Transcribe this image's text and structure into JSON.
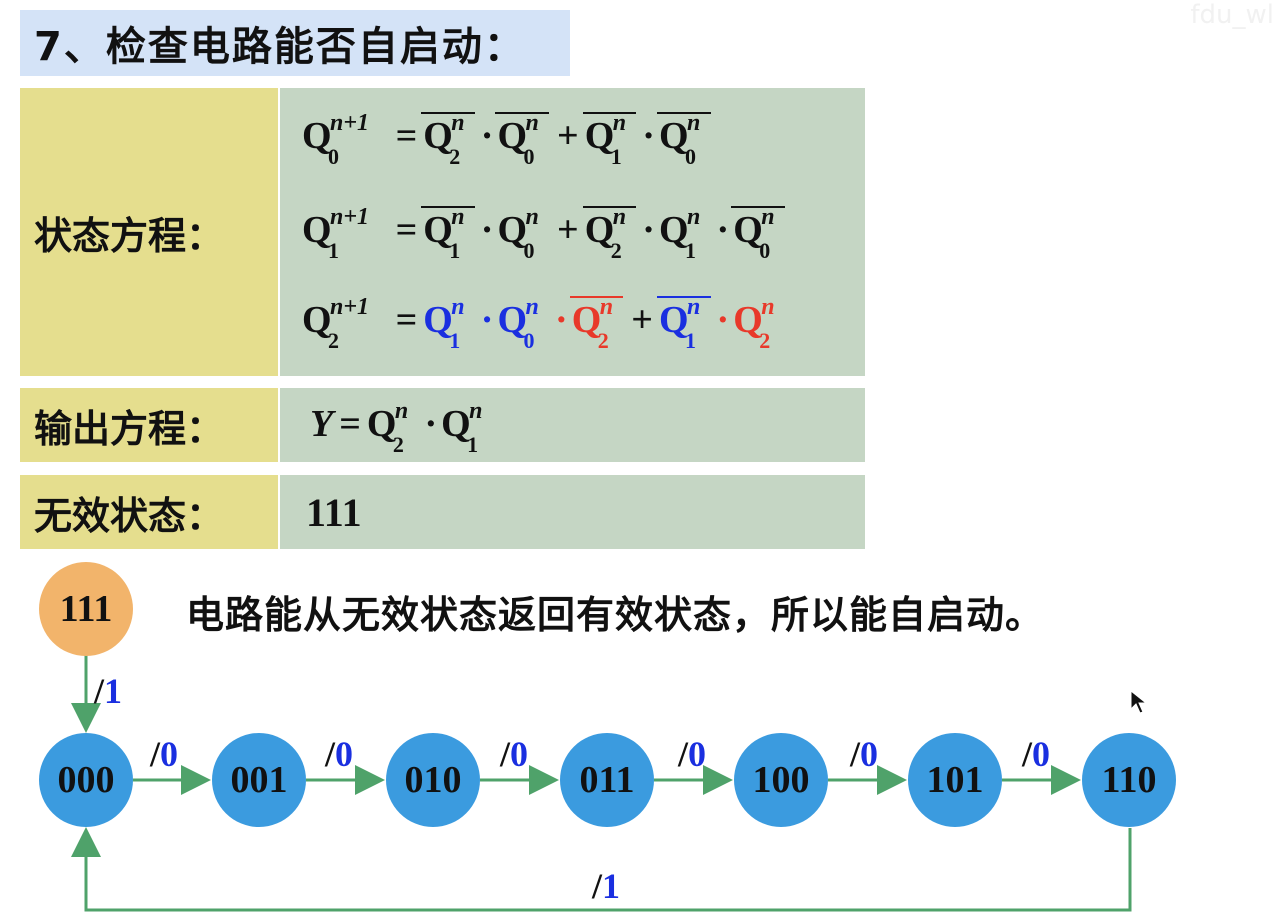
{
  "title": "7、检查电路能否自启动：",
  "watermark": "fdu_wl",
  "labels": {
    "state_eq": "状态方程：",
    "output_eq": "输出方程：",
    "invalid_state": "无效状态："
  },
  "eq": {
    "q": "Q",
    "n": "n",
    "np1": "n+1",
    "s0": "0",
    "s1": "1",
    "s2": "2",
    "eqsign": "=",
    "plus": "+",
    "dot": "·",
    "y": "Y"
  },
  "invalid_value": "111",
  "sentence": "电路能从无效状态返回有效状态，所以能自启动。",
  "diagram": {
    "invalid_node": "111",
    "nodes": [
      "000",
      "001",
      "010",
      "011",
      "100",
      "101",
      "110"
    ],
    "slash": "/",
    "edge_values": [
      "0",
      "0",
      "0",
      "0",
      "0",
      "0"
    ],
    "invalid_edge_value": "1",
    "return_edge_value": "1"
  },
  "colors": {
    "title_bg": "#d4e3f7",
    "label_bg": "#e5de8e",
    "content_bg": "#c5d6c4",
    "node": "#3b9bdf",
    "invalid_node": "#f2b46b",
    "edge": "#4fa26a",
    "blue_term": "#1a2fe0",
    "red_term": "#e8392a"
  }
}
